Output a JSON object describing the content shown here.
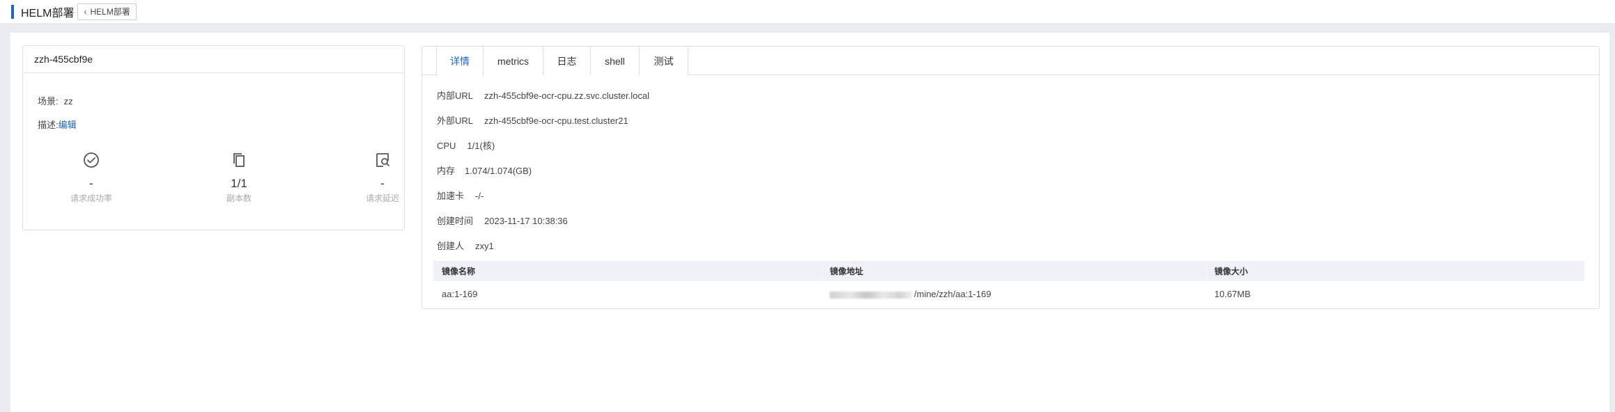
{
  "page": {
    "title": "HELM部署",
    "back_label": "HELM部署"
  },
  "service": {
    "name": "zzh-455cbf9e",
    "scene_label": "场景:",
    "scene_value": "zz",
    "desc_label": "描述:",
    "desc_edit": "编辑",
    "stats": [
      {
        "icon": "check-circle-icon",
        "value": "-",
        "label": "请求成功率"
      },
      {
        "icon": "copy-icon",
        "value": "1/1",
        "label": "副本数"
      },
      {
        "icon": "search-doc-icon",
        "value": "-",
        "label": "请求延迟"
      }
    ]
  },
  "tabs": [
    "详情",
    "metrics",
    "日志",
    "shell",
    "测试"
  ],
  "active_tab": "详情",
  "details": {
    "internal_url_label": "内部URL",
    "internal_url": "zzh-455cbf9e-ocr-cpu.zz.svc.cluster.local",
    "external_url_label": "外部URL",
    "external_url": "zzh-455cbf9e-ocr-cpu.test.cluster21",
    "cpu_label": "CPU",
    "cpu": "1/1(核)",
    "memory_label": "内存",
    "memory": "1.074/1.074(GB)",
    "accel_label": "加速卡",
    "accel": "-/-",
    "created_label": "创建时间",
    "created": "2023-11-17 10:38:36",
    "creator_label": "创建人",
    "creator": "zxy1"
  },
  "image_table": {
    "headers": [
      "镜像名称",
      "镜像地址",
      "镜像大小"
    ],
    "rows": [
      {
        "name": "aa:1-169",
        "address_visible": "/mine/zzh/aa:1-169",
        "size": "10.67MB"
      }
    ]
  },
  "colors": {
    "accent": "#1c64c6",
    "band": "#e8ebf0",
    "table_header": "#eef1f7"
  }
}
